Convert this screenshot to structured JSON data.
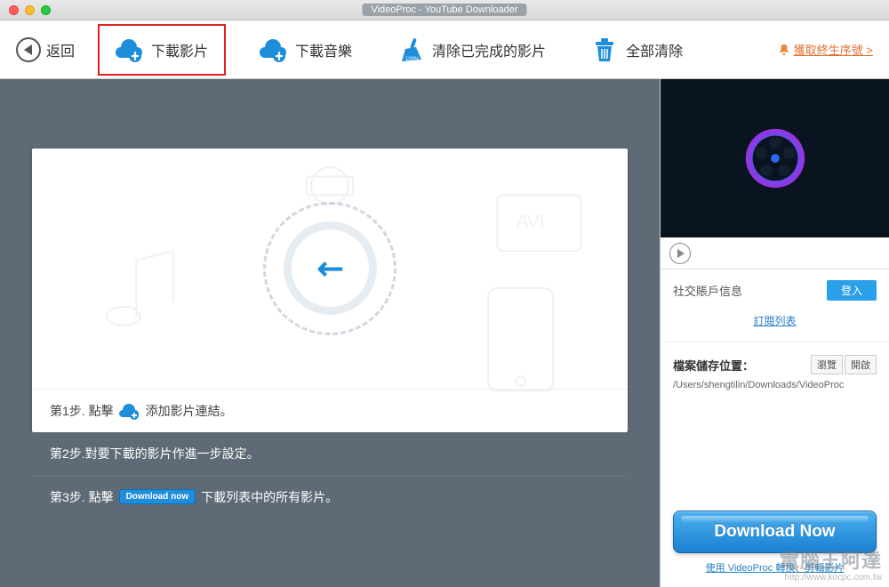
{
  "window": {
    "title": "VideoProc - YouTube Downloader"
  },
  "toolbar": {
    "back": "返回",
    "download_video": "下載影片",
    "download_music": "下載音樂",
    "clear_completed": "清除已完成的影片",
    "clear_all": "全部清除",
    "license_link": "獲取終生序號 >"
  },
  "steps": {
    "s1_prefix": "第1步. 點擊",
    "s1_suffix": "添加影片連結。",
    "s2": "第2步.對要下載的影片作進一步設定。",
    "s3_prefix": "第3步. 點擊",
    "s3_badge": "Download now",
    "s3_suffix": "下載列表中的所有影片。"
  },
  "side": {
    "social_label": "社交賬戶信息",
    "login": "登入",
    "subscribe": "訂閱列表",
    "save_label": "檔案儲存位置：",
    "browse": "瀏覽",
    "open": "開啟",
    "save_path": "/Users/shengtilin/Downloads/VideoProc",
    "download_now": "Download Now",
    "footer_link": "使用 VideoProc 轉換、剪輯影片"
  },
  "watermark": {
    "brand": "電腦王阿達",
    "url": "http://www.kocpc.com.tw"
  },
  "colors": {
    "accent": "#1e8ddb",
    "highlight_box": "#e02020"
  }
}
